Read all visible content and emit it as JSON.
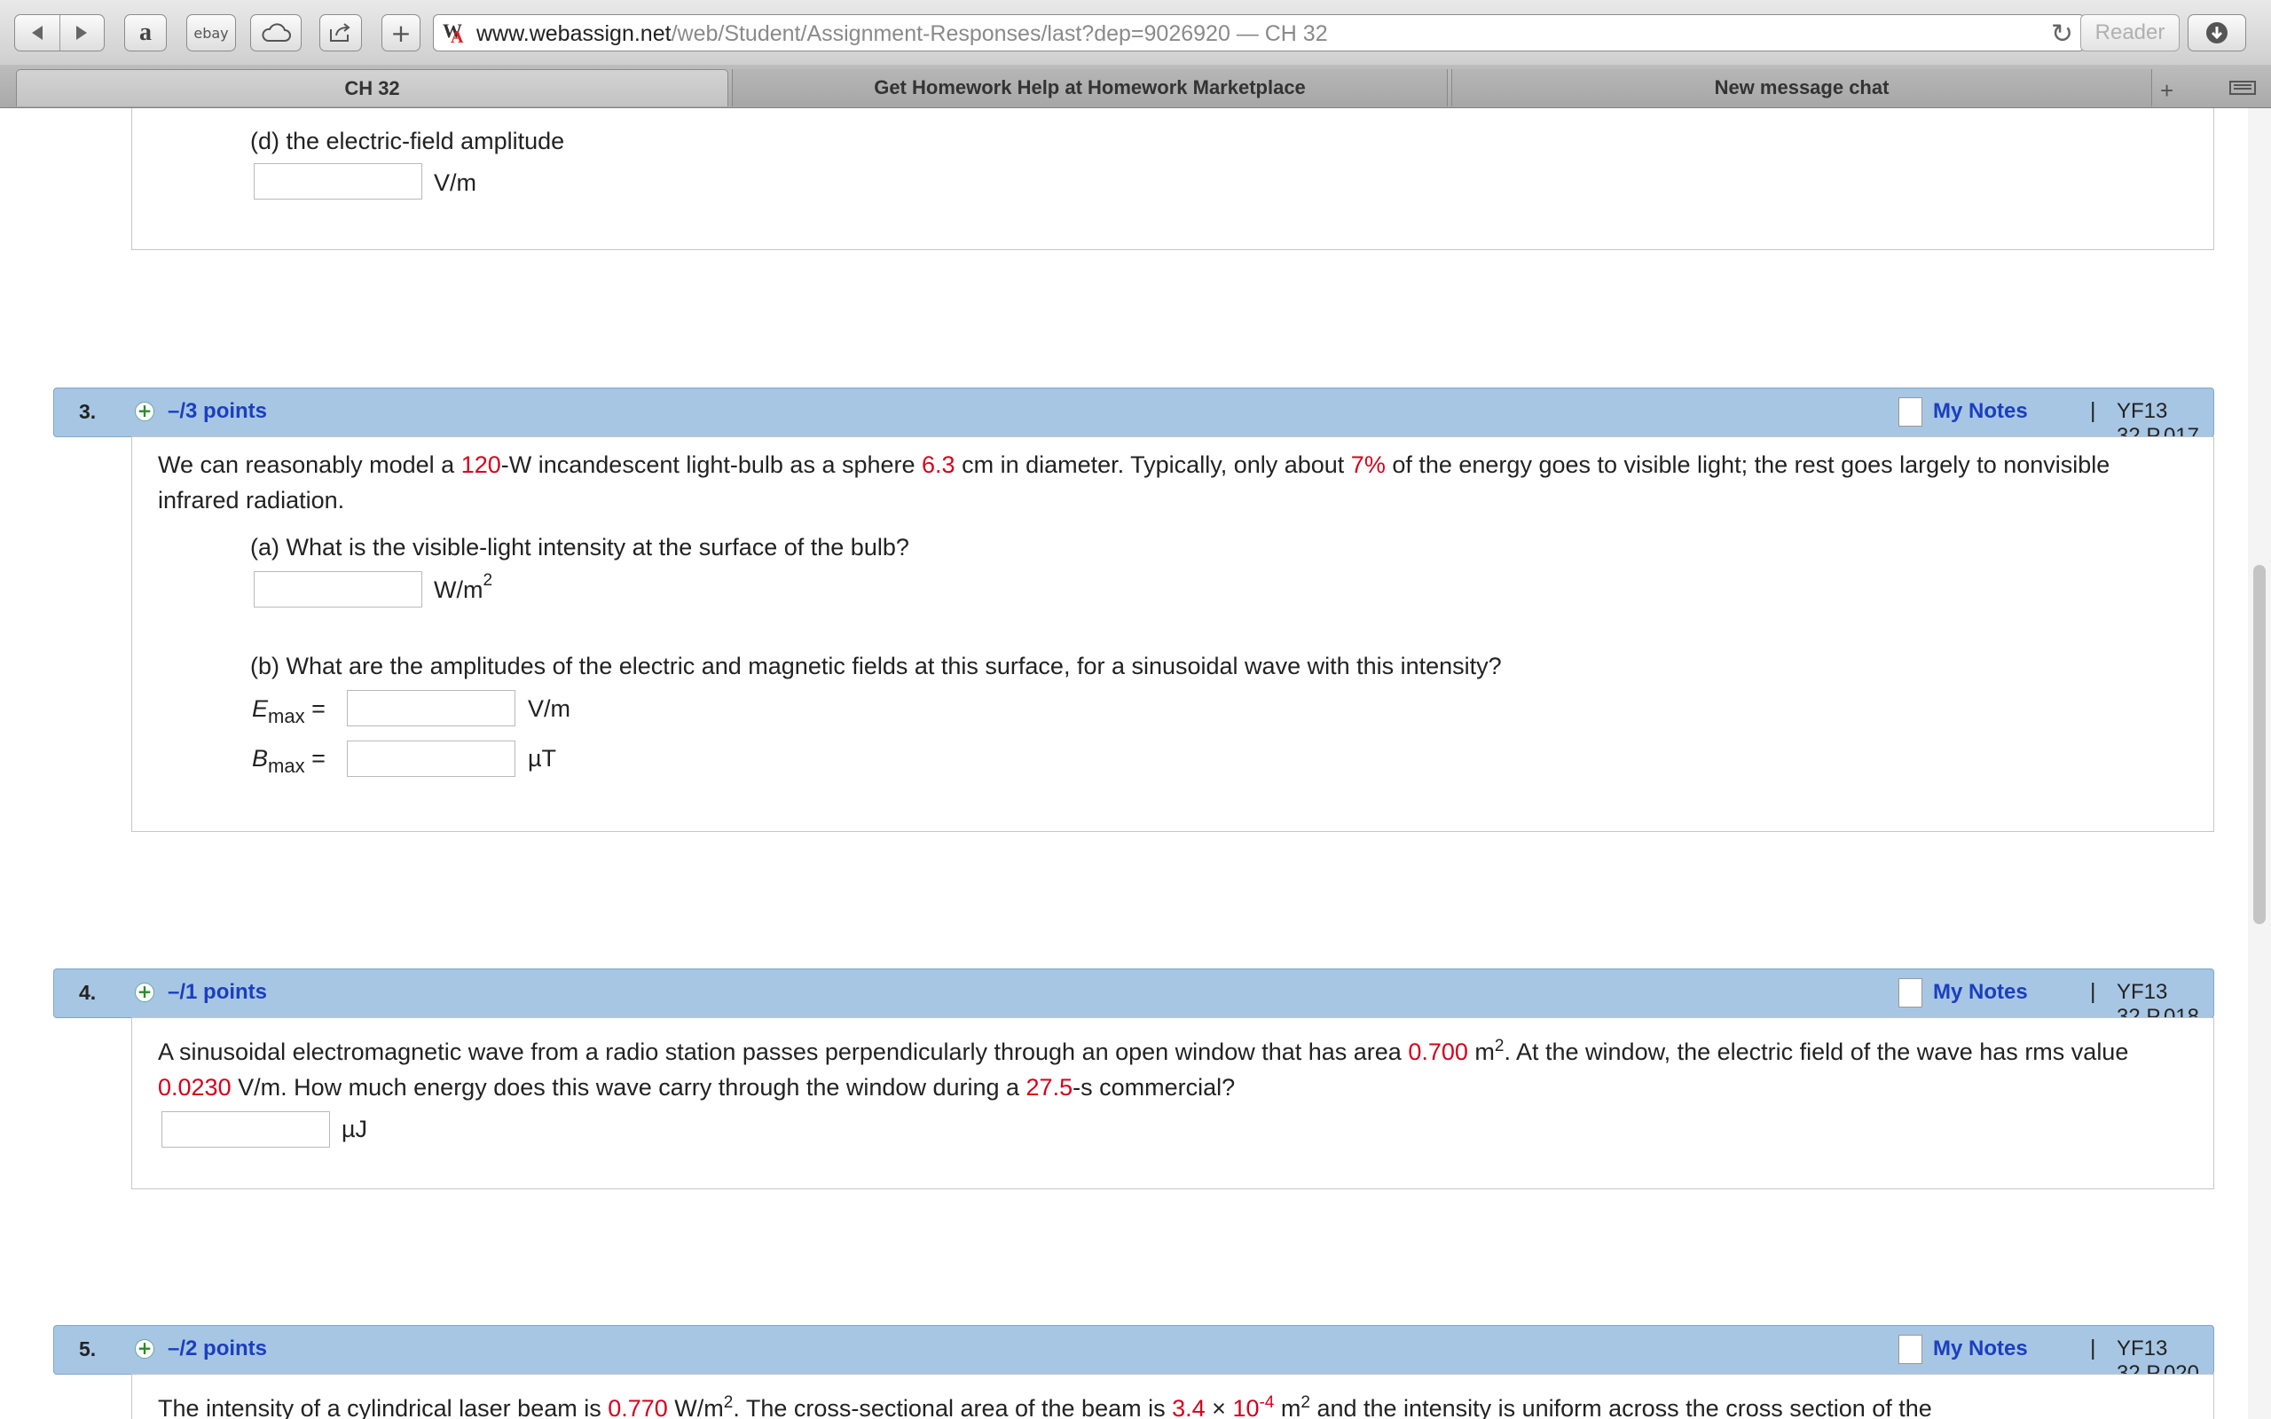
{
  "browser": {
    "url_host": "www.webassign.net",
    "url_path": "/web/Student/Assignment-Responses/last?dep=9026920",
    "url_title": " — CH 32",
    "reader_label": "Reader",
    "ebay_label": "ebay",
    "tabs": [
      {
        "label": "CH 32",
        "active": true
      },
      {
        "label": "Get Homework Help at Homework Marketplace",
        "active": false
      },
      {
        "label": "New message chat",
        "active": false
      }
    ]
  },
  "question2_partial": {
    "part_d_label": "(d) the electric-field amplitude",
    "part_d_unit": "V/m"
  },
  "questions": [
    {
      "number": "3.",
      "points": "–/3 points",
      "my_notes": "My Notes",
      "separator": "|",
      "id": "YF13 32.P.017.",
      "text": {
        "t1": "We can reasonably model a ",
        "v1": "120",
        "t2": "-W incandescent light-bulb as a sphere ",
        "v2": "6.3",
        "t3": " cm in diameter. Typically, only about ",
        "v3": "7%",
        "t4": " of the energy goes to visible light; the rest goes largely to nonvisible infrared radiation."
      },
      "part_a": {
        "label": "(a) What is the visible-light intensity at the surface of the bulb?",
        "unit": "W/m",
        "unit_sup": "2"
      },
      "part_b": {
        "label": "(b) What are the amplitudes of the electric and magnetic fields at this surface, for a sinusoidal wave with this intensity?",
        "e_var": "E",
        "e_sub": "max",
        "e_eq": " =",
        "e_unit": "V/m",
        "b_var": "B",
        "b_sub": "max",
        "b_eq": " =",
        "b_unit": "µT"
      }
    },
    {
      "number": "4.",
      "points": "–/1 points",
      "my_notes": "My Notes",
      "separator": "|",
      "id": "YF13 32.P.018.",
      "text": {
        "t1": "A sinusoidal electromagnetic wave from a radio station passes perpendicularly through an open window that has area ",
        "v1": "0.700",
        "t2": " m",
        "sup1": "2",
        "t3": ". At the window, the electric field of the wave has rms value ",
        "v2": "0.0230",
        "t4": " V/m. How much energy does this wave carry through the window during a ",
        "v3": "27.5",
        "t5": "-s commercial?"
      },
      "unit": "µJ"
    },
    {
      "number": "5.",
      "points": "–/2 points",
      "my_notes": "My Notes",
      "separator": "|",
      "id": "YF13 32.P.020.",
      "text": {
        "t1": "The intensity of a cylindrical laser beam is ",
        "v1": "0.770",
        "t2": " W/m",
        "sup1": "2",
        "t3": ". The cross-sectional area of the beam is ",
        "v2": "3.4",
        "t4": " × ",
        "v3": "10",
        "v3sup": "-4",
        "t5": " m",
        "sup2": "2",
        "t6": " and the intensity is uniform across the cross section of the"
      }
    }
  ]
}
